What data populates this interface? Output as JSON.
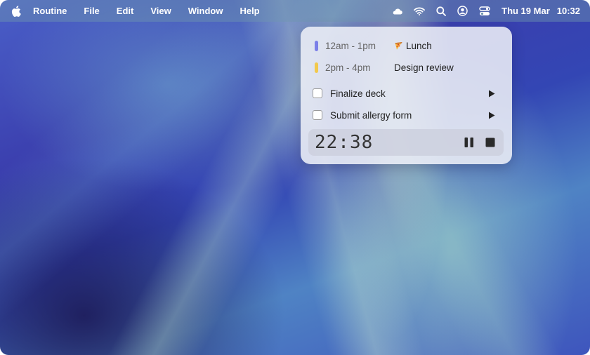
{
  "menubar": {
    "apple_icon": "apple-logo-icon",
    "app_name": "Routine",
    "menus": [
      "File",
      "Edit",
      "View",
      "Window",
      "Help"
    ],
    "status_icons": [
      "cloud-icon",
      "wifi-icon",
      "search-icon",
      "user-account-icon",
      "control-center-icon"
    ],
    "date": "Thu 19 Mar",
    "time": "10:32"
  },
  "widget": {
    "events": [
      {
        "time": "12am - 1pm",
        "title": "Lunch",
        "emoji": "pizza-icon",
        "color": "#7b7fe8"
      },
      {
        "time": "2pm - 4pm",
        "title": "Design review",
        "color": "#f2c94c"
      }
    ],
    "tasks": [
      {
        "label": "Finalize deck",
        "checked": false
      },
      {
        "label": "Submit allergy form",
        "checked": false
      }
    ],
    "timer": {
      "value": "22:38",
      "pause_icon": "pause-icon",
      "stop_icon": "stop-icon"
    }
  }
}
